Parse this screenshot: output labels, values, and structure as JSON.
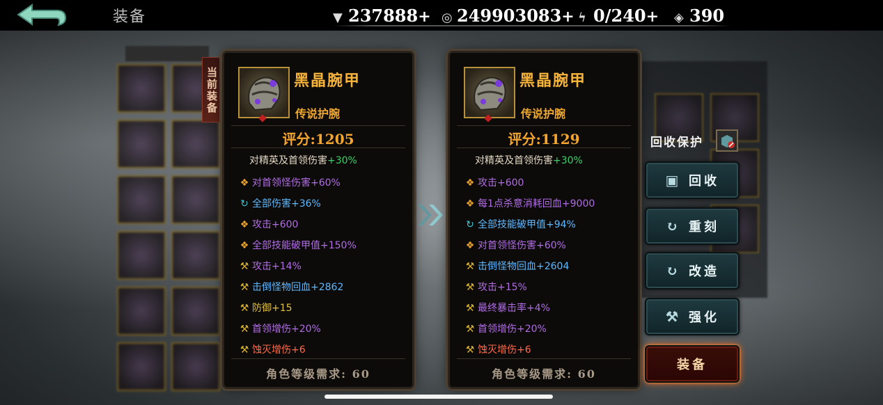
{
  "header": {
    "title": "装备",
    "currencies": [
      {
        "icon": "silver-ingot-icon",
        "value": "237888",
        "plus": "+"
      },
      {
        "icon": "coin-icon",
        "value": "249903083",
        "plus": "+"
      },
      {
        "icon": "lightning-icon",
        "value": "0/240",
        "plus": "+"
      },
      {
        "icon": "ticket-icon",
        "value": "390",
        "plus": ""
      }
    ]
  },
  "current_tag": "当前装备",
  "panel_current": {
    "name": "黑晶腕甲",
    "type": "传说护腕",
    "score_label": "评分:",
    "score": "1205",
    "base_stat": {
      "label": "对精英及首领伤害",
      "value": "+30%"
    },
    "stats": [
      {
        "icon": "orange",
        "label": "对首领怪伤害",
        "value": "+60%",
        "color": "purple"
      },
      {
        "icon": "teal",
        "label": "全部伤害",
        "value": "+36%",
        "color": "blue"
      },
      {
        "icon": "orange",
        "label": "攻击",
        "value": "+600",
        "color": "purple"
      },
      {
        "icon": "orange",
        "label": "全部技能破甲值",
        "value": "+150%",
        "color": "purple"
      },
      {
        "icon": "yellow",
        "label": "攻击",
        "value": "+14%",
        "color": "purple"
      },
      {
        "icon": "yellow",
        "label": "击倒怪物回血",
        "value": "+2862",
        "color": "blue"
      },
      {
        "icon": "yellow",
        "label": "防御",
        "value": "+15",
        "color": "gold"
      },
      {
        "icon": "yellow",
        "label": "首领增伤",
        "value": "+20%",
        "color": "purple"
      },
      {
        "icon": "yellow",
        "label": "蚀灭增伤",
        "value": "+6",
        "color": "red"
      }
    ],
    "requirement": "角色等级需求: 60"
  },
  "panel_new": {
    "name": "黑晶腕甲",
    "type": "传说护腕",
    "score_label": "评分:",
    "score": "1129",
    "base_stat": {
      "label": "对精英及首领伤害",
      "value": "+30%"
    },
    "stats": [
      {
        "icon": "orange",
        "label": "攻击",
        "value": "+600",
        "color": "purple"
      },
      {
        "icon": "orange",
        "label": "每1点杀意消耗回血",
        "value": "+9000",
        "color": "purple"
      },
      {
        "icon": "teal",
        "label": "全部技能破甲值",
        "value": "+94%",
        "color": "blue"
      },
      {
        "icon": "orange",
        "label": "对首领怪伤害",
        "value": "+60%",
        "color": "purple"
      },
      {
        "icon": "yellow",
        "label": "击倒怪物回血",
        "value": "+2604",
        "color": "blue"
      },
      {
        "icon": "yellow",
        "label": "攻击",
        "value": "+15%",
        "color": "purple"
      },
      {
        "icon": "yellow",
        "label": "最终暴击率",
        "value": "+4%",
        "color": "purple"
      },
      {
        "icon": "yellow",
        "label": "首领增伤",
        "value": "+20%",
        "color": "purple"
      },
      {
        "icon": "yellow",
        "label": "蚀灭增伤",
        "value": "+6",
        "color": "red"
      }
    ],
    "requirement": "角色等级需求: 60"
  },
  "actions": {
    "protect_label": "回收保护",
    "recycle": "回收",
    "reforge": "重刻",
    "modify": "改造",
    "enhance": "强化",
    "equip": "装备"
  },
  "colors": {
    "accent_gold": "#f3a52e",
    "stat_green": "#3bd06a",
    "button_teal": "#1f3a40",
    "equip_glow": "#ff6a1a"
  }
}
